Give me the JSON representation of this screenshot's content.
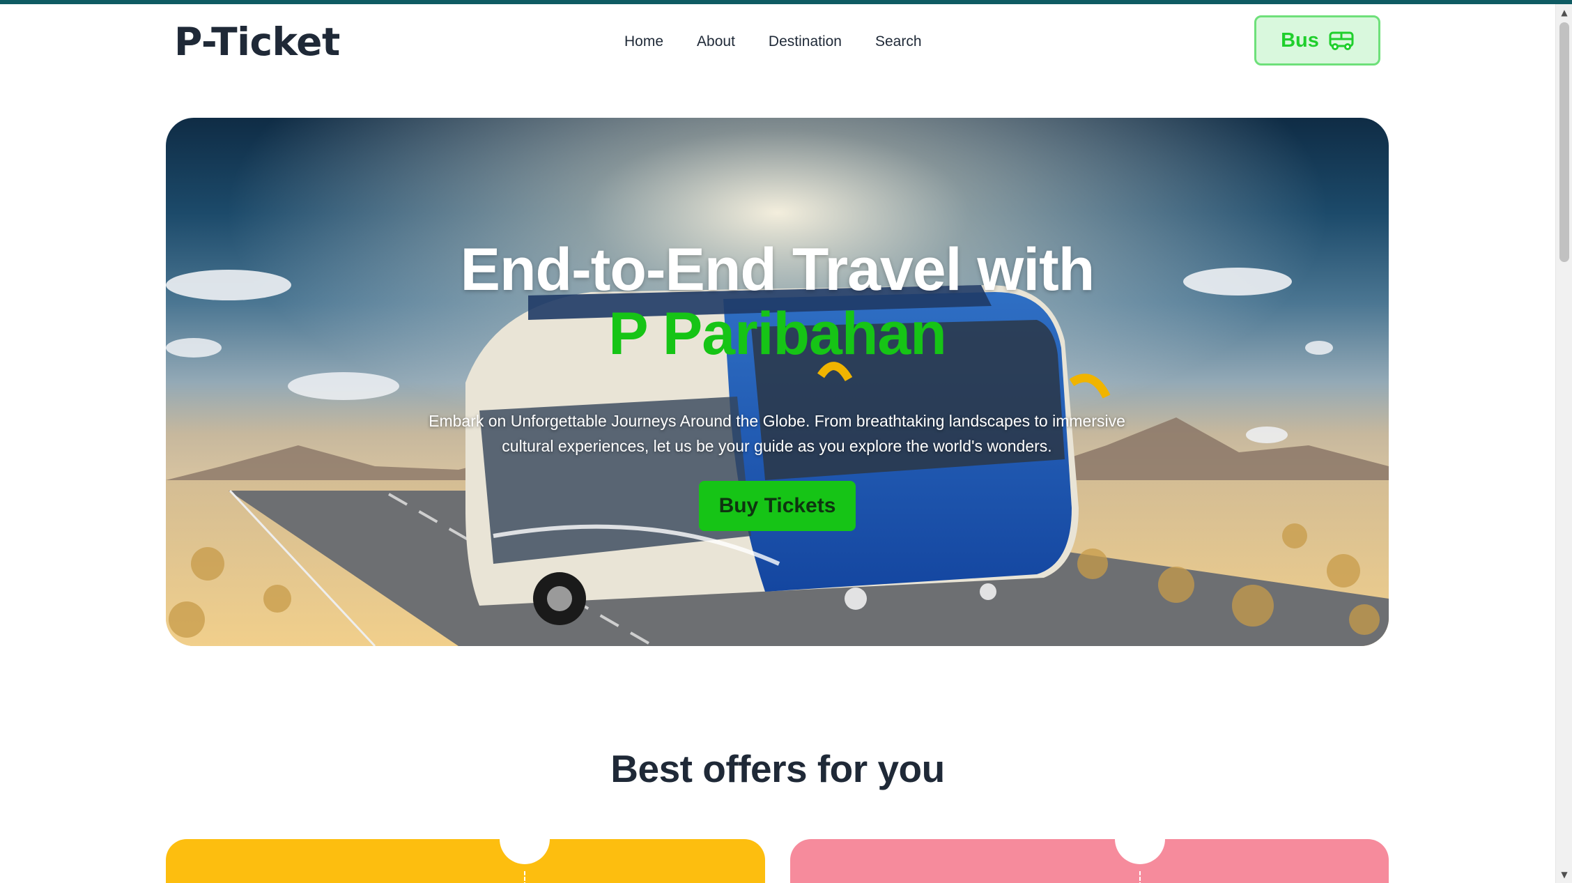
{
  "navbar": {
    "logo": "P-Ticket",
    "links": [
      "Home",
      "About",
      "Destination",
      "Search"
    ],
    "bus_button": "Bus"
  },
  "hero": {
    "title_line1": "End-to-End Travel with",
    "title_line2": "P Paribahan",
    "description": "Embark on Unforgettable Journeys Around the Globe. From breathtaking landscapes to immersive cultural experiences, let us be your guide as you explore the world's wonders.",
    "cta": "Buy Tickets"
  },
  "offers": {
    "title": "Best offers for you",
    "cards": [
      {
        "color": "#fdbe0f"
      },
      {
        "color": "#f68b9c"
      }
    ]
  },
  "colors": {
    "brand_green": "#16c416",
    "top_strip": "#0f5b63",
    "heading_dark": "#1f2937"
  },
  "icons": {
    "bus": "bus-icon"
  }
}
